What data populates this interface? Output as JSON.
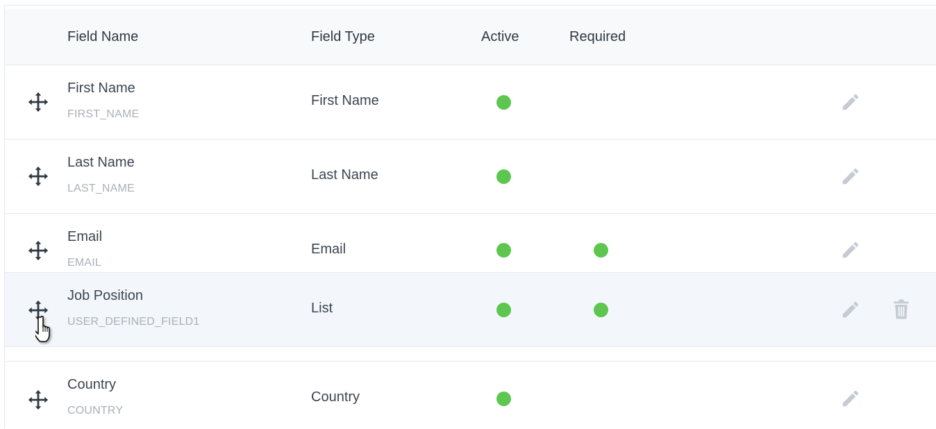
{
  "table": {
    "headers": {
      "field_name": "Field Name",
      "field_type": "Field Type",
      "active": "Active",
      "required": "Required"
    },
    "rows": [
      {
        "name": "First Name",
        "key": "FIRST_NAME",
        "type": "First Name",
        "active": true,
        "required": false,
        "hovered": false
      },
      {
        "name": "Last Name",
        "key": "LAST_NAME",
        "type": "Last Name",
        "active": true,
        "required": false,
        "hovered": false
      },
      {
        "name": "Email",
        "key": "EMAIL",
        "type": "Email",
        "active": true,
        "required": true,
        "hovered": false
      },
      {
        "name": "Job Position",
        "key": "USER_DEFINED_FIELD1",
        "type": "List",
        "active": true,
        "required": true,
        "hovered": true
      },
      {
        "name": "Country",
        "key": "COUNTRY",
        "type": "Country",
        "active": true,
        "required": false,
        "hovered": false
      }
    ]
  },
  "icons": {
    "drag_handle": "move-arrows-icon",
    "edit": "pencil-icon",
    "delete": "trash-icon",
    "cursor": "hand-pointer-cursor-icon"
  },
  "colors": {
    "status_dot": "#5cc64e",
    "header_bg": "#f8f9fb",
    "hover_row_bg": "#f3f7fb",
    "icon_gray": "#c5cbd2"
  }
}
